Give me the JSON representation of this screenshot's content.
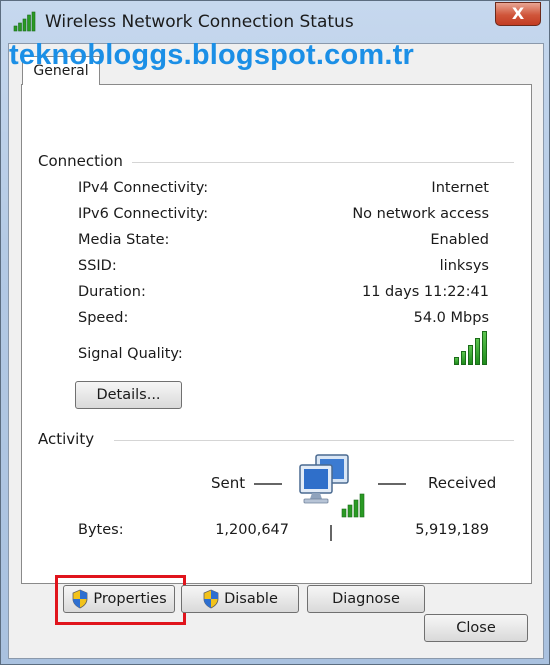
{
  "window": {
    "title": "Wireless Network Connection Status",
    "close_symbol": "X"
  },
  "tab": {
    "label": "General"
  },
  "watermark": "teknobloggs.blogspot.com.tr",
  "connection": {
    "group_label": "Connection",
    "rows": [
      {
        "label": "IPv4 Connectivity:",
        "value": "Internet"
      },
      {
        "label": "IPv6 Connectivity:",
        "value": "No network access"
      },
      {
        "label": "Media State:",
        "value": "Enabled"
      },
      {
        "label": "SSID:",
        "value": "linksys"
      },
      {
        "label": "Duration:",
        "value": "11 days 11:22:41"
      },
      {
        "label": "Speed:",
        "value": "54.0 Mbps"
      }
    ],
    "signal_label": "Signal Quality:",
    "signal_level": "5 of 5 bars",
    "details_button": "Details..."
  },
  "activity": {
    "group_label": "Activity",
    "sent_label": "Sent",
    "received_label": "Received",
    "bytes_label": "Bytes:",
    "bytes_sent": "1,200,647",
    "bytes_received": "5,919,189"
  },
  "buttons": {
    "properties": "Properties",
    "disable": "Disable",
    "diagnose": "Diagnose",
    "close": "Close"
  },
  "colors": {
    "highlight": "#e0141c",
    "watermark": "#1b8fe6",
    "signal_green": "#2a9a24"
  }
}
